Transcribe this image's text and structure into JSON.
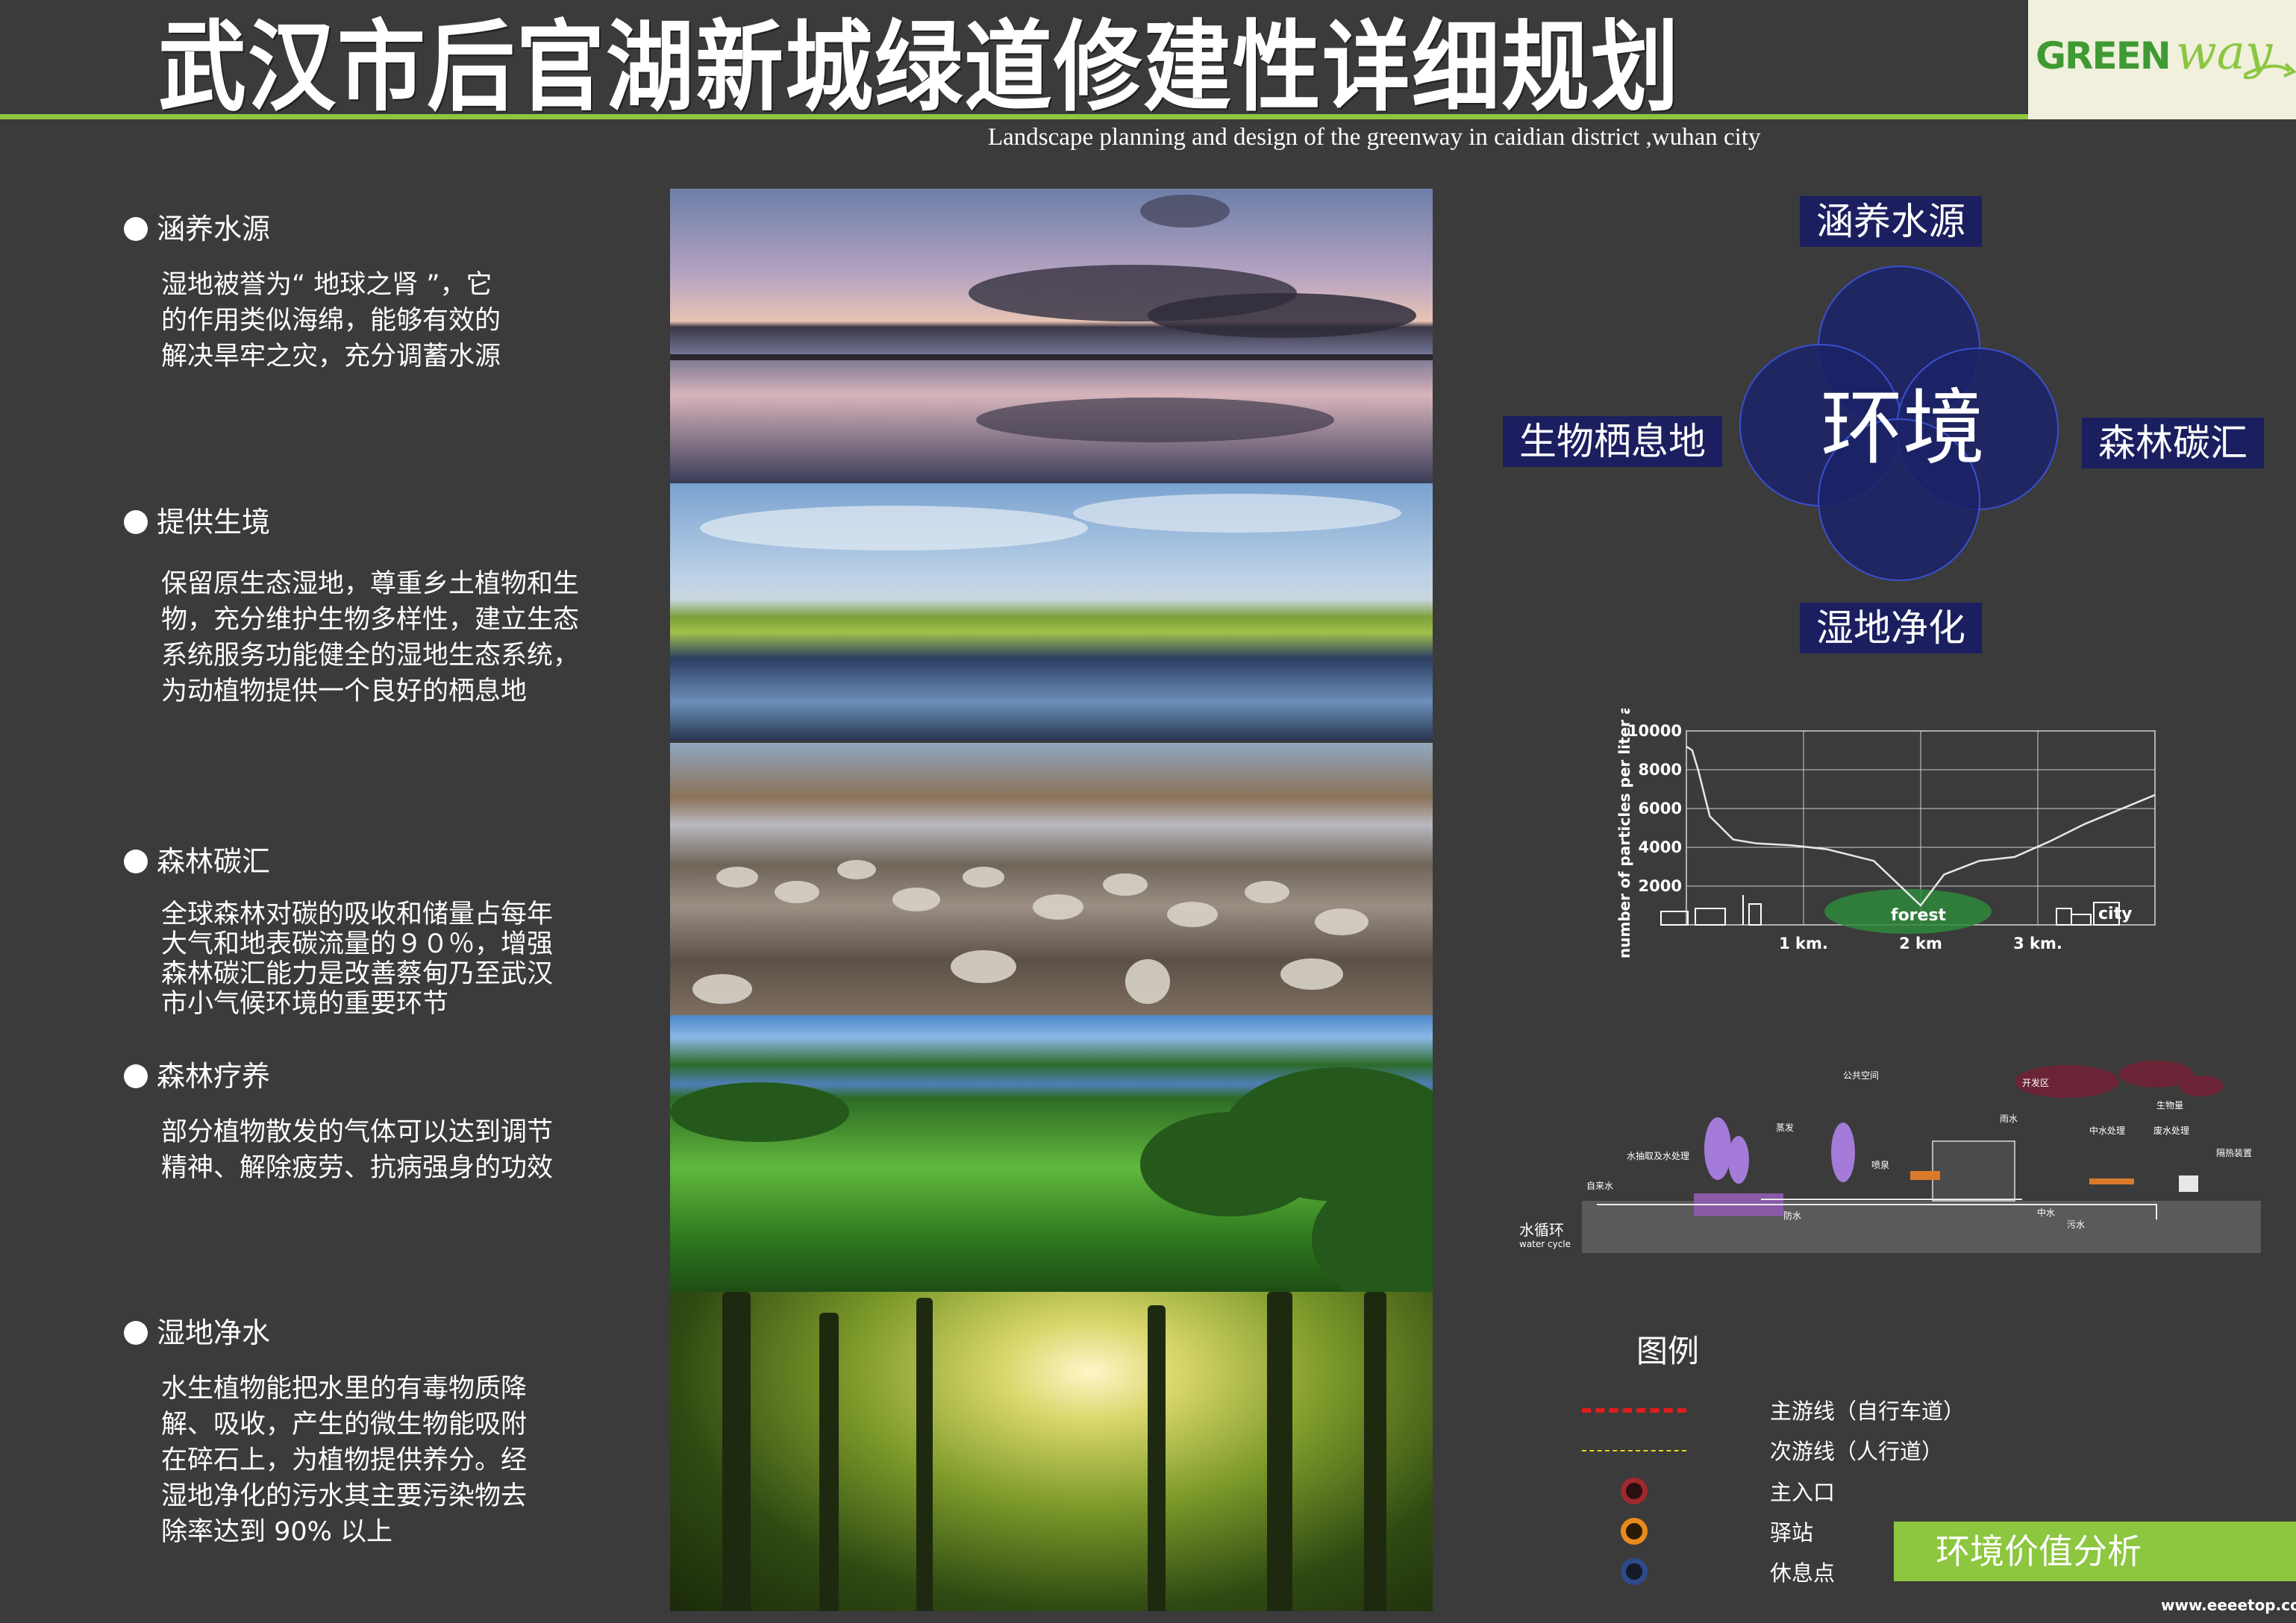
{
  "header": {
    "title": "武汉市后官湖新城绿道修建性详细规划",
    "subtitle": "Landscape planning and design of the greenway in caidian district ,wuhan city",
    "logo": {
      "text_main": "GREEN",
      "text_script": "way"
    }
  },
  "sections": [
    {
      "heading": "涵养水源",
      "lines": [
        "湿地被誉为“ 地球之肾 ”，它",
        "的作用类似海绵，能够有效的",
        "解决旱牢之灾，充分调蓄水源"
      ]
    },
    {
      "heading": "提供生境",
      "lines": [
        "保留原生态湿地，尊重乡土植物和生",
        "物，充分维护生物多样性，建立生态",
        "系统服务功能健全的湿地生态系统，",
        "为动植物提供一个良好的栖息地"
      ]
    },
    {
      "heading": "森林碳汇",
      "lines": [
        "全球森林对碳的吸收和储量占每年",
        "大气和地表碳流量的９０％，增强",
        "森林碳汇能力是改善蔡甸乃至武汉",
        "市小气候环境的重要环节"
      ]
    },
    {
      "heading": "森林疗养",
      "lines": [
        "部分植物散发的气体可以达到调节",
        "精神、解除疲劳、抗病强身的功效"
      ]
    },
    {
      "heading": "湿地净水",
      "lines": [
        "水生植物能把水里的有毒物质降",
        "解、吸收，产生的微生物能吸附",
        "在碎石上，为植物提供养分。经",
        "湿地净化的污水其主要污染物去",
        "除率达到 90% 以上"
      ]
    }
  ],
  "diagram": {
    "center": "环境",
    "top": "涵养水源",
    "left": "生物栖息地",
    "right": "森林碳汇",
    "bottom": "湿地净化",
    "circle_color": "#1b2366"
  },
  "chart_data": {
    "type": "line",
    "ylabel": "number of particles per liter air",
    "yticks": [
      "10000",
      "8000",
      "6000",
      "4000",
      "2000"
    ],
    "ylim": [
      0,
      10000
    ],
    "xticks": [
      "1 km.",
      "2 km",
      "3 km."
    ],
    "annotations": [
      "forest",
      "city"
    ],
    "x": [
      0.0,
      0.05,
      0.1,
      0.2,
      0.4,
      0.6,
      0.9,
      1.2,
      1.6,
      2.0,
      2.2,
      2.5,
      2.8,
      3.1,
      3.4,
      3.8,
      4.0
    ],
    "y": [
      9200,
      9000,
      8000,
      5600,
      4400,
      4200,
      4100,
      3900,
      3300,
      1000,
      2600,
      3300,
      3500,
      4300,
      5200,
      6200,
      6700
    ],
    "grid": true
  },
  "water_cycle": {
    "left_label": "水循环",
    "left_label_en": "water cycle",
    "labels": [
      "自来水",
      "水抽取及水处理",
      "蒸发",
      "喷泉",
      "公共空间",
      "开发区",
      "雨水",
      "中水处理",
      "生物量",
      "废水处理",
      "隔热装置",
      "防水",
      "中水",
      "污水"
    ]
  },
  "legend": {
    "title": "图例",
    "items": [
      {
        "label": "主游线（自行车道）",
        "symbol": "dash-red",
        "color": "#e21b1b"
      },
      {
        "label": "次游线（人行道）",
        "symbol": "dash-yellow",
        "color": "#e6d61e"
      },
      {
        "label": "主入口",
        "symbol": "dot",
        "color": "#a0282e"
      },
      {
        "label": "驿站",
        "symbol": "dot",
        "color": "#e88b1d"
      },
      {
        "label": "休息点",
        "symbol": "dot",
        "color": "#2d4a8a"
      }
    ]
  },
  "badge": "环境价值分析",
  "watermark": "www.eeeetop.com"
}
